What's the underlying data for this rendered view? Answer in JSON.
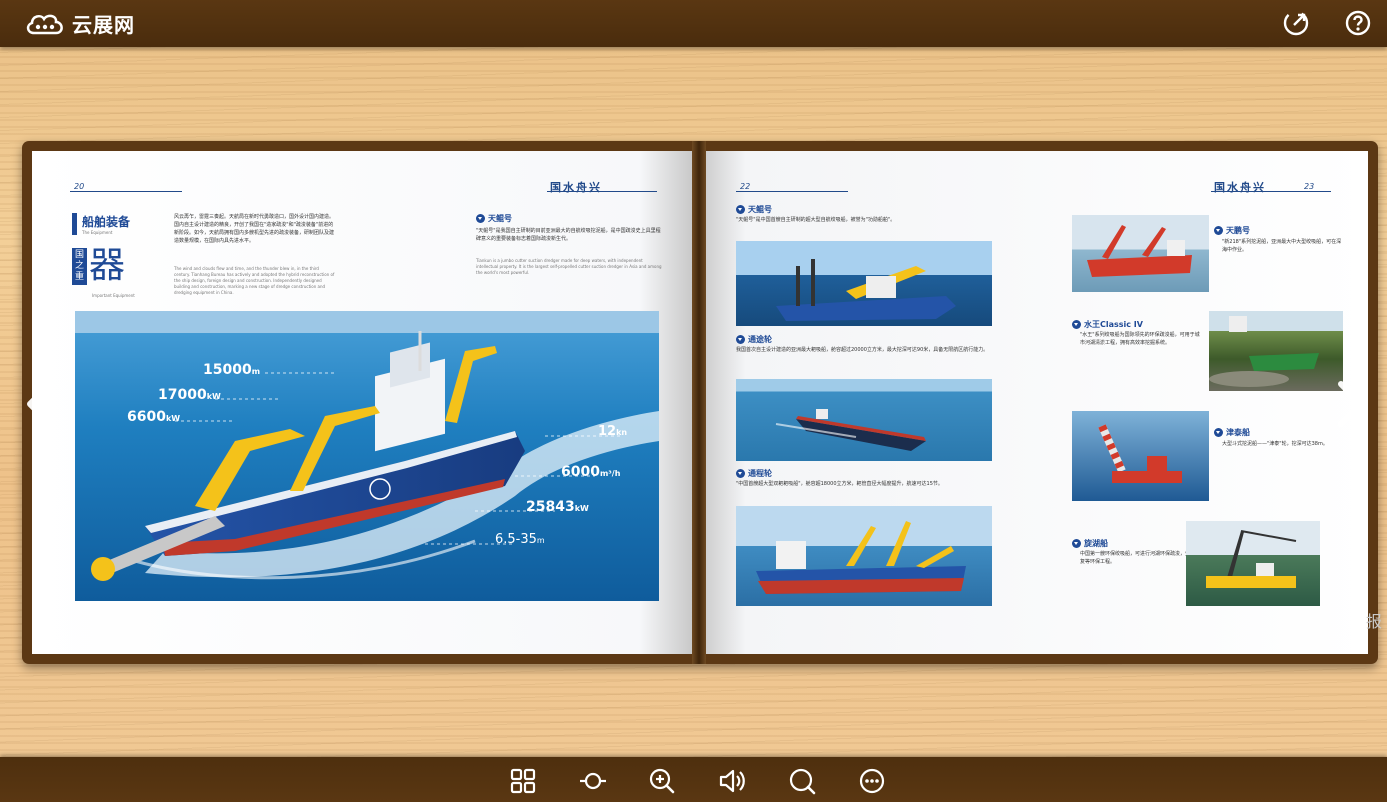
{
  "header": {
    "brand": "云展网",
    "share_icon": "share-icon",
    "help_icon": "help-icon"
  },
  "book": {
    "left_page": {
      "page_number": "20",
      "section_title": "船舶装备",
      "section_subtitle": "The Equipment",
      "banner_small_1": "国",
      "banner_small_2": "之",
      "banner_small_3": "重",
      "banner_big": "器",
      "banner_sub": "Important Equipment",
      "intro_cn": "风云再乍，雷霆三奏起。天航局在新时代勇敢造口，国外设计国内建造。国内自主设计建造的精良，开创了我国在\"造家疏浚\"和\"疏浚装备\"前进的新阶段。如今，天航局拥有国内多艘机型先进的疏浚装备，研制团队及建造数量规模，在国际内具先进水平。",
      "intro_en": "The wind and clouds flew and time, and the thunder blew in, in the third century. Tianhang Bureau has actively and adopted the hybrid reconstruction of the ship design, foreign design and construction. Independently designed building and construction, marking a new stage of dredge construction and dredging equipment in China.",
      "ship_title": "天鲲号",
      "ship_desc_cn": "\"天鲲号\"是我国自主研制的目前亚洲最大的自航绞吸挖泥船，是中国疏浚史上具里程碑意义的重要装备标志着国际疏浚新生代。",
      "ship_desc_en": "Tiankun is a jumbo cutter suction dredger made for deep waters, with independent intellectual property. It is the largest self-propelled cutter suction dredger in Asia and among the world's most powerful.",
      "callouts": [
        {
          "value": "15000",
          "unit": "m"
        },
        {
          "value": "17000",
          "unit": "kW"
        },
        {
          "value": "6600",
          "unit": "kW"
        },
        {
          "value": "12",
          "unit": "kn"
        },
        {
          "value": "6000",
          "unit": "m³/h"
        },
        {
          "value": "25843",
          "unit": "kW"
        },
        {
          "value": "6.5-35",
          "unit": "m"
        }
      ]
    },
    "right_page": {
      "page_numbers": [
        "22",
        "23"
      ],
      "brand_mark": "国水舟兴",
      "sections": [
        {
          "title": "天鲲号",
          "text": "\"天鲲号\"是中国首艘自主研制的超大型自航绞吸船，被誉为\"功勋船舶\"。"
        },
        {
          "title": "通途轮",
          "text": "我国首次自主设计建造的亚洲最大耙吸船，舱容超过20000立方米，最大挖深可达90米，具备无限航区航行能力。"
        },
        {
          "title": "通程轮",
          "text": "\"中国首艘超大型双耙耙吸船\"，舱容超18000立方米，耙管直径大幅度提升，航速可达15节。"
        },
        {
          "title": "天鹏号",
          "text": "\"新218\"系列挖泥船，亚洲最大中大型绞吸船，可在深海中作业。"
        },
        {
          "title": "水王Classic IV",
          "text": "\"水王\"系列绞吸船为国际领先的环保疏浚船，可用于城市河湖清淤工程，拥有高效率挖掘系统。"
        },
        {
          "title": "津泰船",
          "text": "大型斗式挖泥船——\"津泰\"轮，挖深可达38m。"
        },
        {
          "title": "旋湖船",
          "text": "中国第一艘环保绞吸船，可进行河湖环保疏浚，生态修复等环保工程。"
        }
      ]
    },
    "side_ghost": "报"
  },
  "toolbar": {
    "items": [
      "thumbnails-icon",
      "autoflip-icon",
      "zoom-in-icon",
      "sound-icon",
      "search-icon",
      "more-icon"
    ]
  },
  "colors": {
    "bar_brown": "#4e2f0e",
    "accent_blue": "#1f4a96",
    "ship_blue": "#1b4fa0",
    "crane_yellow": "#f4c21a"
  }
}
